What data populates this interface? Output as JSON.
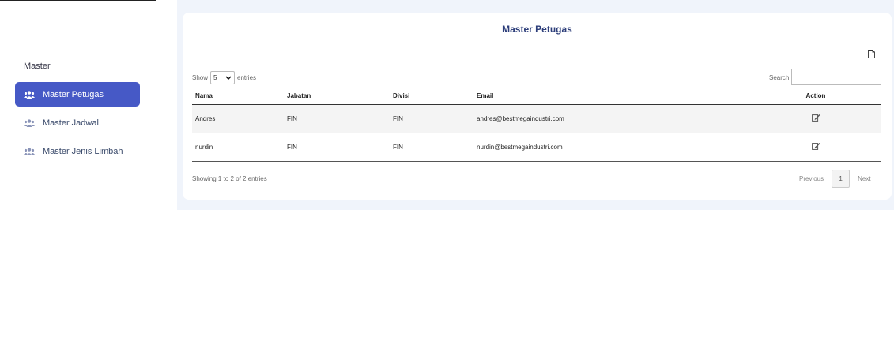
{
  "sidebar": {
    "heading": "Master",
    "items": [
      {
        "label": "Master Petugas",
        "active": true,
        "icon": "users-icon"
      },
      {
        "label": "Master Jadwal",
        "active": false,
        "icon": "users-icon"
      },
      {
        "label": "Master Jenis Limbah",
        "active": false,
        "icon": "users-icon"
      }
    ]
  },
  "card": {
    "title": "Master Petugas",
    "show_label": "Show",
    "entries_value": "5",
    "entries_label": "entries",
    "search_label": "Search:",
    "search_value": "",
    "columns": [
      "Nama",
      "Jabatan",
      "Divisi",
      "Email",
      "Action"
    ],
    "rows": [
      {
        "nama": "Andres",
        "jabatan": "FIN",
        "divisi": "FIN",
        "email": "andres@bestmegaindustri.com"
      },
      {
        "nama": "nurdin",
        "jabatan": "FIN",
        "divisi": "FIN",
        "email": "nurdin@bestmegaindustri.com"
      }
    ],
    "info": "Showing 1 to 2 of 2 entries",
    "pager": {
      "prev": "Previous",
      "page": "1",
      "next": "Next"
    }
  },
  "colors": {
    "accent": "#4659c6",
    "title": "#2d3e7a",
    "background": "#f0f4fb"
  }
}
